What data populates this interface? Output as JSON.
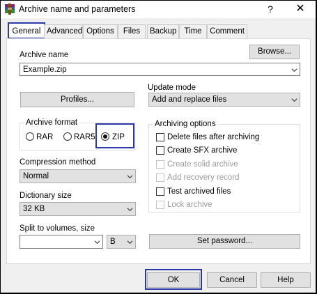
{
  "window": {
    "title": "Archive name and parameters",
    "help_glyph": "?",
    "close_glyph": "✕"
  },
  "tabs": [
    "General",
    "Advanced",
    "Options",
    "Files",
    "Backup",
    "Time",
    "Comment"
  ],
  "general": {
    "archive_name_label": "Archive name",
    "archive_name_value": "Example.zip",
    "browse_label": "Browse...",
    "profiles_label": "Profiles...",
    "update_mode_label": "Update mode",
    "update_mode_value": "Add and replace files",
    "archive_format_label": "Archive format",
    "formats": [
      {
        "label": "RAR",
        "selected": false
      },
      {
        "label": "RAR5",
        "selected": false
      },
      {
        "label": "ZIP",
        "selected": true
      }
    ],
    "compression_label": "Compression method",
    "compression_value": "Normal",
    "dictionary_label": "Dictionary size",
    "dictionary_value": "32 KB",
    "split_label": "Split to volumes, size",
    "split_value": "",
    "split_unit": "B",
    "archiving_options_label": "Archiving options",
    "options": [
      {
        "label": "Delete files after archiving",
        "checked": false,
        "enabled": true
      },
      {
        "label": "Create SFX archive",
        "checked": false,
        "enabled": true
      },
      {
        "label": "Create solid archive",
        "checked": false,
        "enabled": false
      },
      {
        "label": "Add recovery record",
        "checked": false,
        "enabled": false
      },
      {
        "label": "Test archived files",
        "checked": false,
        "enabled": true
      },
      {
        "label": "Lock archive",
        "checked": false,
        "enabled": false
      }
    ],
    "set_password_label": "Set password..."
  },
  "footer": {
    "ok_label": "OK",
    "cancel_label": "Cancel",
    "help_label": "Help"
  },
  "colors": {
    "highlight": "#2b3aa6",
    "button_face": "#e1e1e1"
  }
}
